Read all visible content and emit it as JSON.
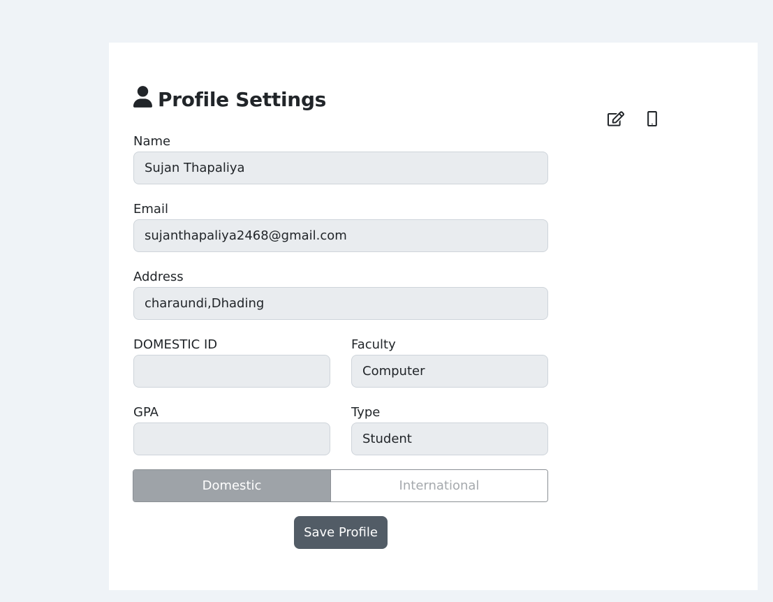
{
  "page": {
    "title": "Profile Settings",
    "title_icon": "user-icon"
  },
  "toolbar": {
    "edit_icon": "edit-icon",
    "mobile_icon": "mobile-icon"
  },
  "form": {
    "name": {
      "label": "Name",
      "value": "Sujan Thapaliya"
    },
    "email": {
      "label": "Email",
      "value": "sujanthapaliya2468@gmail.com"
    },
    "address": {
      "label": "Address",
      "value": "charaundi,Dhading"
    },
    "domestic_id": {
      "label": "DOMESTIC ID",
      "value": ""
    },
    "faculty": {
      "label": "Faculty",
      "value": "Computer"
    },
    "gpa": {
      "label": "GPA",
      "value": ""
    },
    "type": {
      "label": "Type",
      "value": "Student"
    }
  },
  "student_type_toggle": {
    "options": [
      "Domestic",
      "International"
    ],
    "selected": "Domestic"
  },
  "actions": {
    "save_label": "Save Profile"
  },
  "colors": {
    "page_bg": "#eff3f7",
    "card_bg": "#ffffff",
    "field_bg": "#e9ecef",
    "toggle_active": "#9ea3a8",
    "save_button": "#525c66"
  }
}
